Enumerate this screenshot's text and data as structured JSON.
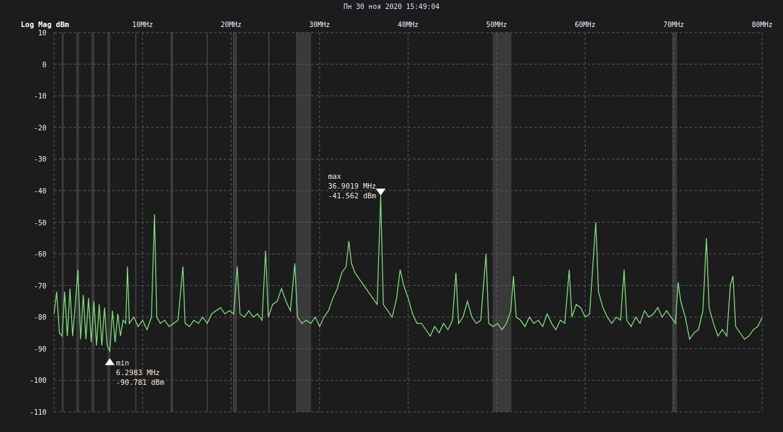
{
  "chart_data": {
    "type": "line",
    "title": "Пн 30 ноя 2020 15:49:04",
    "ylabel": "Log Mag dBm",
    "xlim": [
      0,
      80
    ],
    "ylim": [
      -110,
      10
    ],
    "xticks": [
      {
        "value": 10,
        "label": "10MHz"
      },
      {
        "value": 20,
        "label": "20MHz"
      },
      {
        "value": 30,
        "label": "30MHz"
      },
      {
        "value": 40,
        "label": "40MHz"
      },
      {
        "value": 50,
        "label": "50MHz"
      },
      {
        "value": 60,
        "label": "60MHz"
      },
      {
        "value": 70,
        "label": "70MHz"
      },
      {
        "value": 80,
        "label": "80MHz"
      }
    ],
    "yticks": [
      10,
      0,
      -10,
      -20,
      -30,
      -40,
      -50,
      -60,
      -70,
      -80,
      -90,
      -100,
      -110
    ],
    "x": [
      0,
      0.3,
      0.6,
      0.9,
      1.2,
      1.5,
      1.8,
      2.1,
      2.4,
      2.7,
      3.0,
      3.3,
      3.6,
      3.9,
      4.2,
      4.5,
      4.8,
      5.1,
      5.4,
      5.7,
      6.0,
      6.3,
      6.6,
      6.9,
      7.2,
      7.5,
      7.8,
      8.1,
      8.3,
      8.5,
      9.0,
      9.5,
      10.0,
      10.5,
      11.0,
      11.35,
      11.6,
      12.0,
      12.5,
      13.0,
      13.5,
      14.0,
      14.56,
      14.8,
      15.3,
      15.8,
      16.3,
      16.8,
      17.3,
      17.8,
      18.3,
      18.8,
      19.3,
      19.8,
      20.3,
      20.7,
      21.0,
      21.5,
      22.0,
      22.5,
      23.0,
      23.5,
      23.9,
      24.2,
      24.7,
      25.2,
      25.7,
      26.2,
      26.7,
      27.2,
      27.5,
      28.0,
      28.5,
      29.0,
      29.5,
      30.0,
      30.5,
      31.0,
      31.5,
      32.0,
      32.5,
      33.0,
      33.3,
      33.6,
      34.0,
      34.5,
      35.0,
      35.5,
      36.0,
      36.5,
      36.9,
      37.2,
      37.7,
      38.2,
      38.7,
      39.1,
      39.5,
      40.0,
      40.5,
      41.0,
      41.5,
      42.0,
      42.5,
      43.0,
      43.5,
      44.0,
      44.5,
      45.0,
      45.4,
      45.7,
      46.2,
      46.7,
      47.2,
      47.7,
      48.2,
      48.8,
      49.1,
      49.6,
      50.1,
      50.6,
      51.1,
      51.6,
      51.9,
      52.2,
      52.7,
      53.2,
      53.7,
      54.2,
      54.7,
      55.2,
      55.7,
      56.2,
      56.7,
      57.2,
      57.7,
      58.2,
      58.5,
      59.0,
      59.5,
      60.0,
      60.5,
      61.2,
      61.5,
      62.0,
      62.5,
      63.0,
      63.5,
      64.0,
      64.4,
      64.7,
      65.2,
      65.7,
      66.2,
      66.7,
      67.2,
      67.7,
      68.2,
      68.7,
      69.2,
      69.7,
      70.2,
      70.5,
      70.8,
      71.3,
      71.8,
      72.3,
      72.8,
      73.3,
      73.7,
      74.0,
      74.5,
      75.0,
      75.5,
      76.0,
      76.4,
      76.7,
      77.0,
      77.5,
      78.0,
      78.5,
      79.0,
      79.5,
      80.0
    ],
    "grid": true,
    "series": [
      {
        "color": "#7ee07a",
        "values": [
          -79,
          -72,
          -85,
          -86,
          -72,
          -86,
          -71,
          -86,
          -76,
          -65,
          -87,
          -73,
          -87,
          -74,
          -88,
          -75,
          -89,
          -76,
          -89,
          -77,
          -89,
          -90.8,
          -78,
          -88,
          -79,
          -86,
          -81,
          -82,
          -64,
          -82,
          -80,
          -83,
          -81,
          -84,
          -80,
          -47.5,
          -80,
          -82,
          -81,
          -83,
          -82,
          -81,
          -64,
          -82,
          -83,
          -81,
          -82,
          -80,
          -82,
          -79,
          -78,
          -77,
          -79,
          -78,
          -79,
          -64,
          -79,
          -80,
          -78,
          -80,
          -79,
          -81,
          -59,
          -80,
          -76,
          -75,
          -71,
          -75,
          -78,
          -63,
          -80,
          -82,
          -81,
          -82,
          -80,
          -83,
          -80,
          -78,
          -74,
          -71,
          -66,
          -64,
          -56,
          -63,
          -66,
          -68,
          -70,
          -72,
          -74,
          -76,
          -41.6,
          -76,
          -78,
          -80,
          -74,
          -65,
          -70,
          -74,
          -79,
          -82,
          -82,
          -84,
          -86,
          -83,
          -85,
          -82,
          -84,
          -81,
          -66,
          -82,
          -80,
          -75,
          -80,
          -82,
          -81,
          -60,
          -82,
          -83,
          -82,
          -84,
          -82,
          -78,
          -67,
          -80,
          -81,
          -83,
          -80,
          -82,
          -81,
          -83,
          -79,
          -82,
          -84,
          -81,
          -82,
          -65,
          -80,
          -76,
          -77,
          -80,
          -79,
          -50,
          -72,
          -77,
          -80,
          -82,
          -80,
          -81,
          -65,
          -81,
          -83,
          -80,
          -82,
          -78,
          -80,
          -79,
          -77,
          -80,
          -78,
          -80,
          -82,
          -69,
          -75,
          -80,
          -87,
          -85,
          -84,
          -78,
          -55,
          -77,
          -82,
          -86,
          -84,
          -86,
          -70,
          -67,
          -83,
          -85,
          -87,
          -86,
          -84,
          -83,
          -80
        ]
      }
    ],
    "annotations": [
      {
        "text": "max\n36.9019 MHz\n-41.562 dBm",
        "x": 36.9019,
        "y": -41.562
      },
      {
        "text": "min\n6.2983 MHz\n-90.781 dBm",
        "x": 6.2983,
        "y": -90.781
      }
    ]
  }
}
